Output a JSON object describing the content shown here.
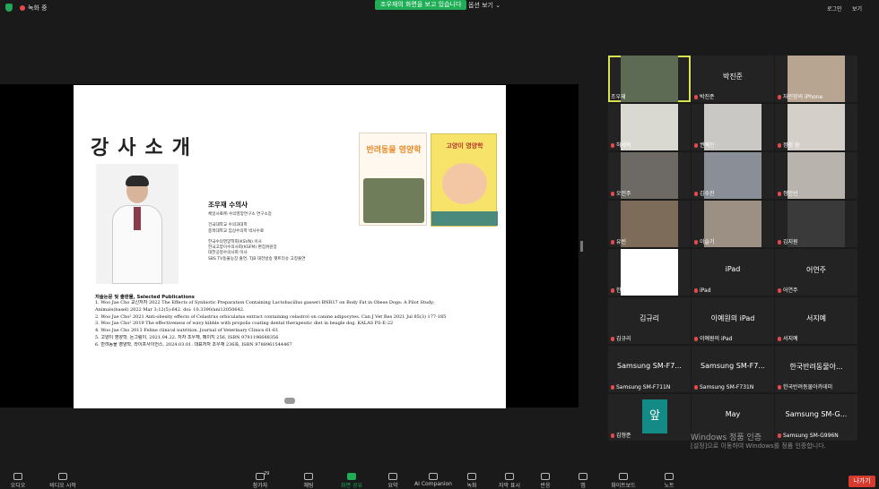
{
  "topbar": {
    "recording": "녹화 중",
    "viewing_banner": "조우재의 화면을 보고 있습니다",
    "view_options": "옵션 보기 ⌄",
    "logo_label": "로그인",
    "view_label": "보기"
  },
  "slide": {
    "title": "강사소개",
    "name": "조우재 수의사",
    "bio": "체일사료㈜ 수의영양연구소 연구소장\n\n건국대학교 수의과대학\n충북대학교 임상수의학 박사수료\n\n한국수의영양학회(KSVN) 이사\n한국고양이수의사회(KSFM) 편집위원장\n대한공정수의사회 이사\nSBS TV동물농장 출연, TJB 대전방송 펫트리슈 고정출연",
    "book1_title": "반려동물 영양학",
    "book2_title": "고양이 영양학",
    "pubs_heading": "저술논문 및 출판물, Selected Publications",
    "pubs": [
      "1.  Woo Jae Cho 교신저자 2022 The Effects of Synbiotic Preparation Containing Lactobacillus gasseri BNR17 on Body Fat in Obese Dogs: A Pilot Study;",
      "     Animals(basel) 2022 Mar 3;12(5):642. doi: 10.3390/ani12050642.",
      "2.  Woo Jae Cho² 2021 Anti-obesity effects of Celastrus orbiculatus extract containing celastrol on canine adipocytes. Can J Vet Res 2021 Jul 85(3) 177-185",
      "3.  Woo Jae Cho² 2019 The effectiveness of wavy kibble with propolis coating dental therapeutic diet in beagle dog. KALAS PS-E-22",
      "4.  Woo Jae Cho 2013 Feline clinical nutrition. Journal of Veterinary Clinics 61-61",
      "5.  고양이 영양학, 돈그림이, 2021.04.22. 저자 조우재, 페이지 256, ISBN 9791196688356",
      "6.  반려동물 영양학, 라이프사이언스, 2024.03.01. 대표저자 조우재 236쪽, ISBN 9788961544467"
    ]
  },
  "participants": [
    {
      "name": "조우재",
      "center": "",
      "muted": false
    },
    {
      "name": "박진준",
      "center": "박진준",
      "muted": true
    },
    {
      "name": "자민장의 iPhone",
      "center": "",
      "muted": true
    },
    {
      "name": "허세혁",
      "center": "",
      "muted": true
    },
    {
      "name": "권예진",
      "center": "",
      "muted": true
    },
    {
      "name": "정청 원",
      "center": "",
      "muted": true
    },
    {
      "name": "오민주",
      "center": "",
      "muted": true
    },
    {
      "name": "김수진",
      "center": "",
      "muted": true
    },
    {
      "name": "정인선",
      "center": "",
      "muted": true
    },
    {
      "name": "유빈",
      "center": "",
      "muted": true
    },
    {
      "name": "이슬기",
      "center": "",
      "muted": true
    },
    {
      "name": "김지원",
      "center": "",
      "muted": true
    },
    {
      "name": "한국반려동물아카데미",
      "center": "",
      "muted": true
    },
    {
      "name": "iPad",
      "center": "iPad",
      "muted": true
    },
    {
      "name": "어연주",
      "center": "어연주",
      "muted": true
    },
    {
      "name": "김규리",
      "center": "김규리",
      "muted": true
    },
    {
      "name": "이예원의 iPad",
      "center": "이예원의 iPad",
      "muted": true
    },
    {
      "name": "서지예",
      "center": "서지예",
      "muted": true
    },
    {
      "name": "Samsung SM-F711N",
      "center": "Samsung SM-F7...",
      "muted": true
    },
    {
      "name": "Samsung SM-F731N",
      "center": "Samsung SM-F7...",
      "muted": true
    },
    {
      "name": "한국반려동물아카데미",
      "center": "한국반려동물아...",
      "muted": true
    },
    {
      "name": "김형준",
      "center": "앞",
      "muted": true
    },
    {
      "name": "",
      "center": "May",
      "muted": false
    },
    {
      "name": "Samsung SM-G996N",
      "center": "Samsung SM-G...",
      "muted": true
    }
  ],
  "windows_watermark": {
    "line1": "Windows 정품 인증",
    "line2": "[설정]으로 이동하여 Windows를 정품 인증합니다."
  },
  "toolbar": {
    "audio": "오디오",
    "video": "비디오 시작",
    "participants": "참가자",
    "participants_count": "29",
    "chat": "채팅",
    "share": "화면 공유",
    "reactions": "요약",
    "ai": "AI Companion",
    "record": "녹화",
    "captions": "자막 표시",
    "polls": "반응",
    "apps": "앱",
    "whiteboard": "화이트보드",
    "notes": "노트",
    "leave": "나가기"
  },
  "colors": {
    "accent_green": "#1fae56",
    "leave_red": "#d63b2f",
    "active_speaker": "#d7e44f"
  }
}
